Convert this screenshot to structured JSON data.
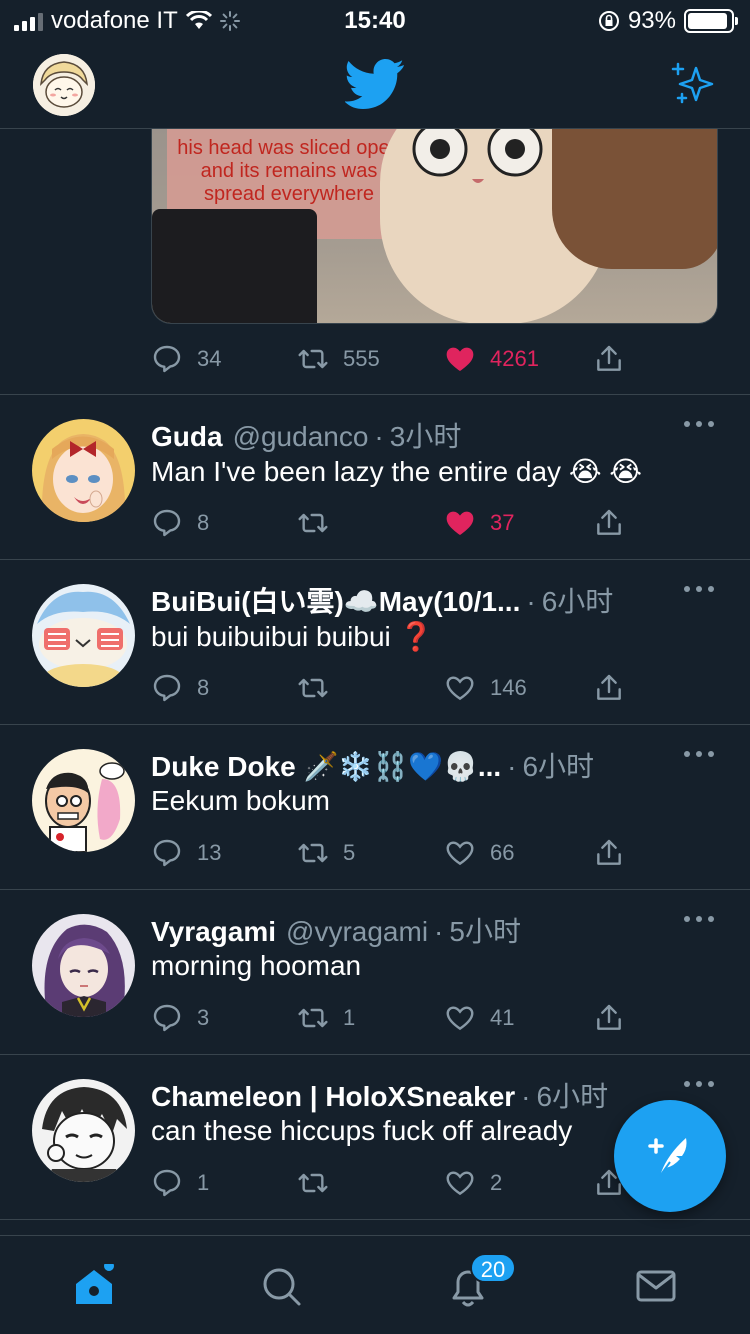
{
  "status_bar": {
    "carrier": "vodafone IT",
    "time": "15:40",
    "battery": "93%",
    "battery_level": 0.93
  },
  "header": {
    "logo_icon": "twitter-bird-icon",
    "sparkle_icon": "sparkle-icon"
  },
  "colors": {
    "background": "#15202b",
    "accent": "#1da1f2",
    "like": "#e0245e",
    "muted": "#8899a6",
    "divider": "#38444d"
  },
  "top_media": {
    "caption": "his head was sliced open and its remains was spread everywhere",
    "replies": "34",
    "retweets": "555",
    "likes": "4261"
  },
  "tweets": [
    {
      "name": "Guda",
      "handle": "@gudanco",
      "dot": "·",
      "time": "3小时",
      "text": "Man I've been lazy the entire day 😭 😭",
      "replies": "8",
      "retweets": "",
      "likes": "37",
      "liked": true
    },
    {
      "name": "BuiBui(白い雲)☁️May(10/1...",
      "handle": "",
      "dot": "·",
      "time": "6小时",
      "text": "bui buibuibui buibui ❓",
      "replies": "8",
      "retweets": "",
      "likes": "146",
      "liked": false
    },
    {
      "name": "Duke Doke 🗡️❄️⛓️💙💀...",
      "handle": "",
      "dot": "·",
      "time": "6小时",
      "text": "Eekum bokum",
      "replies": "13",
      "retweets": "5",
      "likes": "66",
      "liked": false
    },
    {
      "name": "Vyragami",
      "handle": "@vyragami",
      "dot": "·",
      "time": "5小时",
      "text": "morning hooman",
      "replies": "3",
      "retweets": "1",
      "likes": "41",
      "liked": false
    },
    {
      "name": "Chameleon | HoloXSneaker",
      "handle": "",
      "dot": "·",
      "time": "6小时",
      "text": "can these hiccups fuck off already",
      "replies": "1",
      "retweets": "",
      "likes": "2",
      "liked": false
    }
  ],
  "tab_bar": {
    "items": [
      "home-icon",
      "search-icon",
      "notifications-icon",
      "messages-icon"
    ],
    "notification_badge": "20"
  },
  "fab": {
    "icon": "compose-tweet-icon"
  }
}
